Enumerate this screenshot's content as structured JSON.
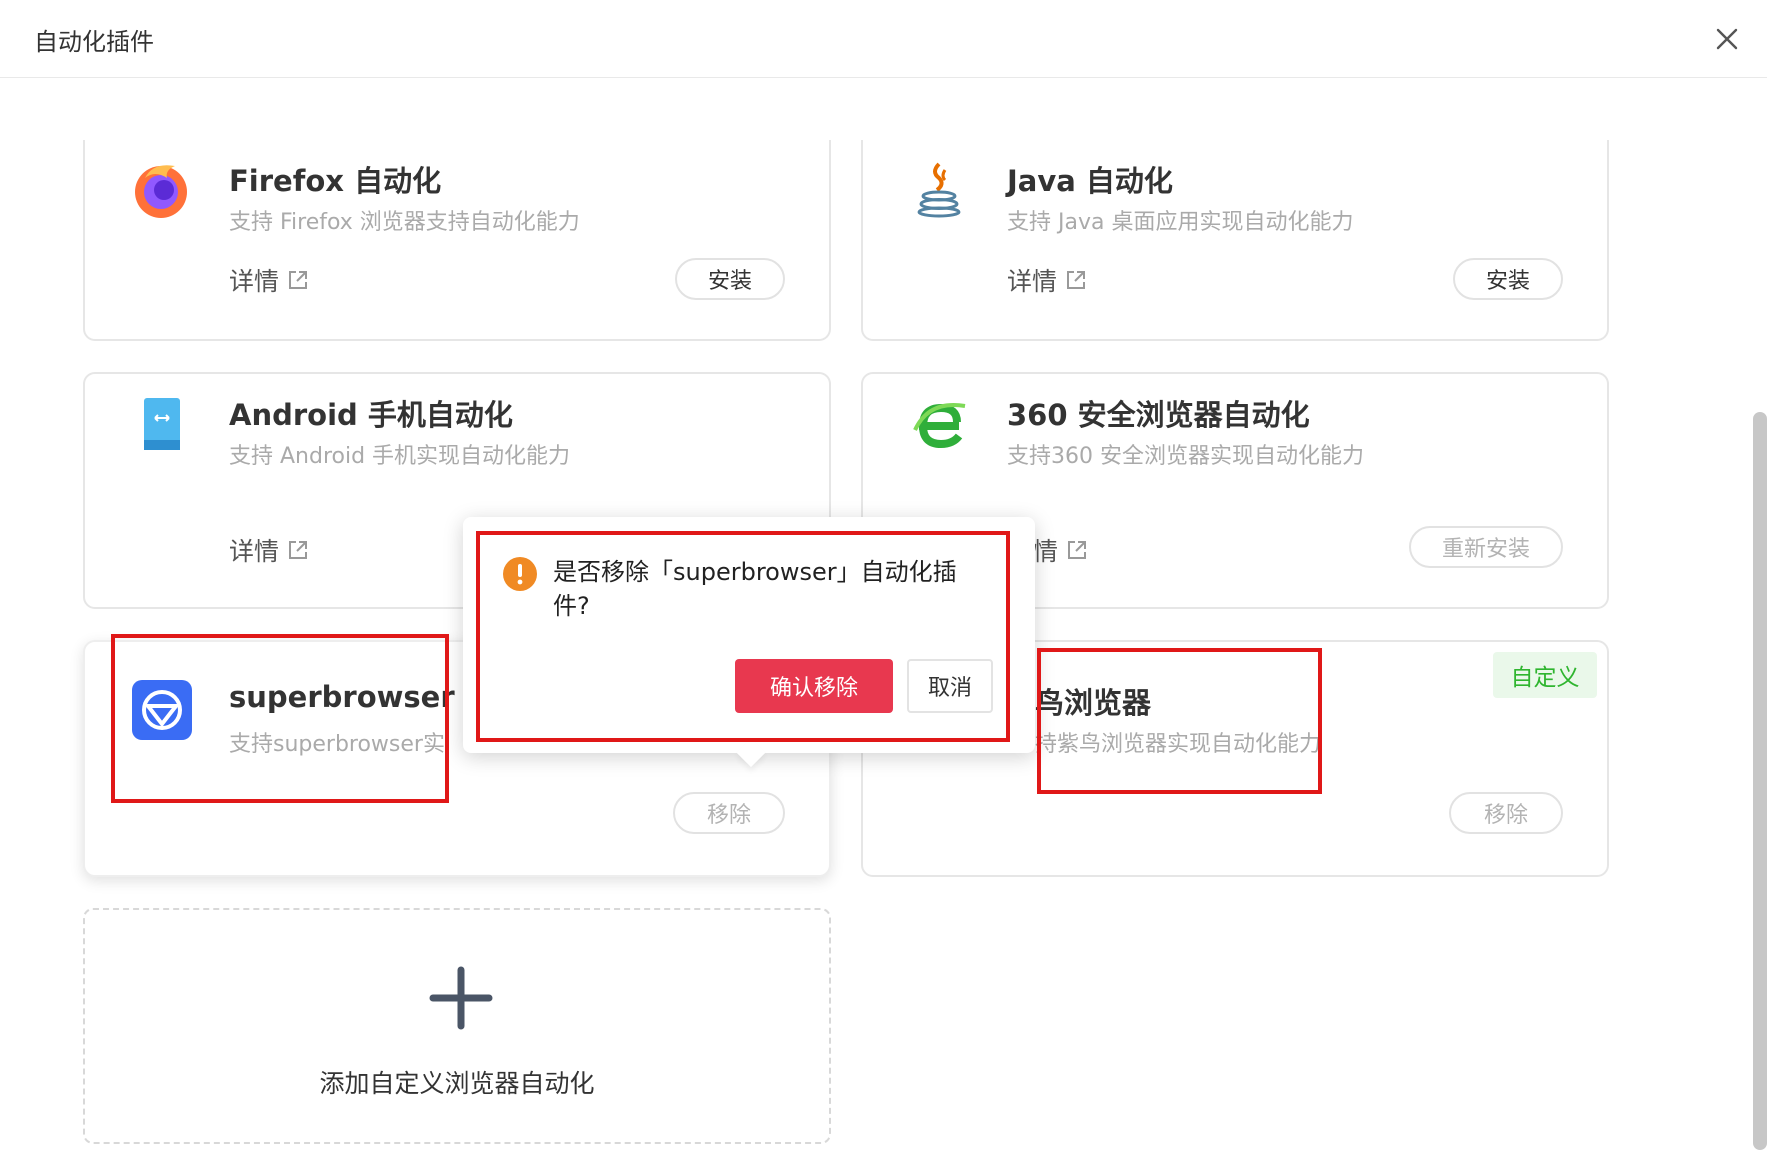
{
  "dialog": {
    "title": "自动化插件",
    "close_icon": "close-icon"
  },
  "plugins": [
    {
      "id": "firefox",
      "name": "Firefox 自动化",
      "desc": "支持 Firefox 浏览器支持自动化能力",
      "detail": "详情",
      "action": "安装",
      "icon": "firefox-icon"
    },
    {
      "id": "java",
      "name": "Java 自动化",
      "desc": "支持 Java 桌面应用实现自动化能力",
      "detail": "详情",
      "action": "安装",
      "icon": "java-icon"
    },
    {
      "id": "android",
      "name": "Android 手机自动化",
      "desc": "支持 Android 手机实现自动化能力",
      "detail": "详情",
      "icon": "android-phone-icon"
    },
    {
      "id": "360",
      "name": "360 安全浏览器自动化",
      "desc": "支持360 安全浏览器实现自动化能力",
      "detail": "情",
      "action": "重新安装",
      "icon": "360-browser-icon"
    },
    {
      "id": "superbrowser",
      "name": "superbrowser",
      "desc": "支持superbrowser实",
      "action": "移除",
      "icon": "superbrowser-icon"
    },
    {
      "id": "purple-bird",
      "name": "鸟浏览器",
      "desc": "持紫鸟浏览器实现自动化能力",
      "tag": "自定义",
      "action": "移除"
    }
  ],
  "add_custom": {
    "label": "添加自定义浏览器自动化",
    "icon": "plus-icon"
  },
  "popconfirm": {
    "message": "是否移除「superbrowser」自动化插件?",
    "confirm": "确认移除",
    "cancel": "取消",
    "icon": "warning-icon"
  },
  "colors": {
    "danger": "#e8384f",
    "warning": "#f08a24",
    "highlight": "#e01818",
    "tag_green": "#2fb52f"
  }
}
